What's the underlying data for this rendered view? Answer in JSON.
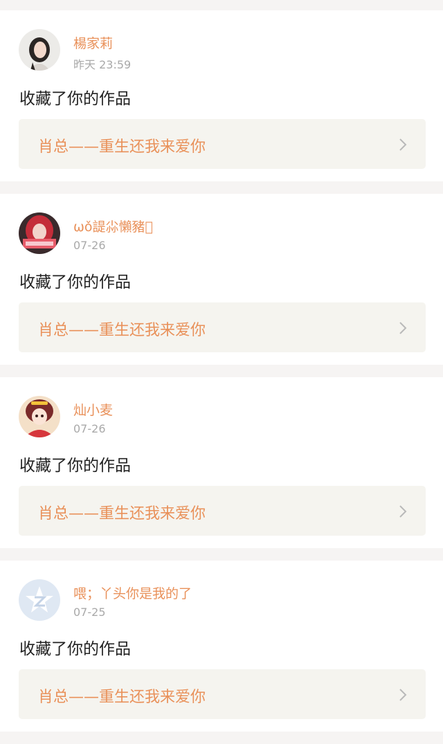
{
  "notifications": [
    {
      "username": "楊家莉",
      "time": "昨天 23:59",
      "action": "收藏了你的作品",
      "work_title": "肖总——重生还我来爱你",
      "avatar_icon": "user-photo-icon"
    },
    {
      "username": "ωǒ諟尛懶豬\u0000",
      "time": "07-26",
      "action": "收藏了你的作品",
      "work_title": "肖总——重生还我来爱你",
      "avatar_icon": "user-photo-icon"
    },
    {
      "username": "灿小麦",
      "time": "07-26",
      "action": "收藏了你的作品",
      "work_title": "肖总——重生还我来爱你",
      "avatar_icon": "anime-avatar-icon"
    },
    {
      "username": "喂；丫头你是我的了",
      "time": "07-25",
      "action": "收藏了你的作品",
      "work_title": "肖总——重生还我来爱你",
      "avatar_icon": "qzone-default-avatar-icon"
    }
  ],
  "colors": {
    "accent": "#e9915a",
    "text": "#222222",
    "muted": "#a9a9a9",
    "card_link_bg": "#f5f4ef",
    "page_bg": "#f6f4f3"
  }
}
